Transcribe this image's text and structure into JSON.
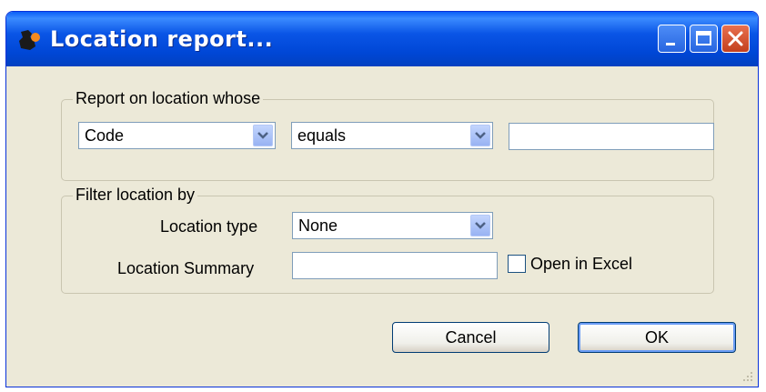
{
  "window": {
    "title": "Location report..."
  },
  "report_on": {
    "legend": "Report on location whose",
    "field_select": "Code",
    "operator_select": "equals",
    "value_input": ""
  },
  "filter": {
    "legend": "Filter location by",
    "location_type_label": "Location type",
    "location_type_value": "None",
    "summary_label": "Location Summary",
    "summary_value": "",
    "open_excel_label": "Open in Excel",
    "open_excel_checked": false
  },
  "buttons": {
    "cancel": "Cancel",
    "ok": "OK"
  },
  "icons": [
    "app-icon",
    "minimize-icon",
    "maximize-icon",
    "close-icon",
    "dropdown-arrow-icon",
    "resize-grip-icon"
  ],
  "colors": {
    "titlebar": "#0a55e6",
    "dialog_bg": "#ece9d8",
    "close_button": "#c3401d"
  }
}
